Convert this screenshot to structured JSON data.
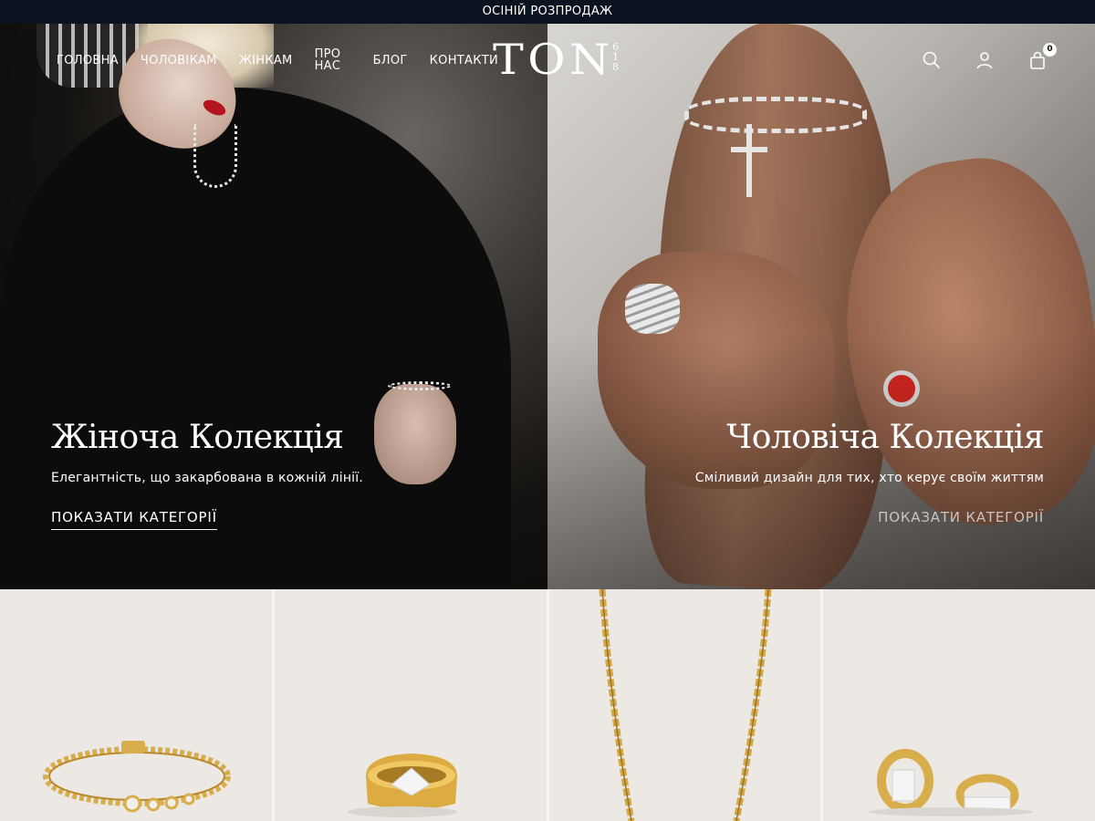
{
  "announcement": {
    "text": "ОСІНІЙ РОЗПРОДАЖ"
  },
  "nav": {
    "items": [
      {
        "label": "ГОЛОВНА"
      },
      {
        "label": "ЧОЛОВІКАМ"
      },
      {
        "label": "ЖІНКАМ"
      },
      {
        "label": "ПРО НАС"
      },
      {
        "label": "БЛОГ"
      },
      {
        "label": "КОНТАКТИ"
      }
    ]
  },
  "logo": {
    "main": "TON",
    "sub": "618"
  },
  "header_icons": {
    "search": "search-icon",
    "account": "user-icon",
    "cart": "bag-icon",
    "cart_count": "0"
  },
  "hero": {
    "women": {
      "title": "Жіноча Колекція",
      "subtitle": "Елегантність, що закарбована в кожній лінії.",
      "cta": "ПОКАЗАТИ КАТЕГОРІЇ"
    },
    "men": {
      "title": "Чоловіча Колекція",
      "subtitle": "Сміливий дизайн для тих, хто керує своїм життям",
      "cta": "ПОКАЗАТИ КАТЕГОРІЇ"
    }
  },
  "products": [
    {
      "name": "bracelet-image"
    },
    {
      "name": "ring-image"
    },
    {
      "name": "chain-image"
    },
    {
      "name": "earrings-image"
    }
  ],
  "colors": {
    "announcement_bg": "#0b1220",
    "gold": "#d8ad4c",
    "product_bg": "#ece9e4"
  }
}
